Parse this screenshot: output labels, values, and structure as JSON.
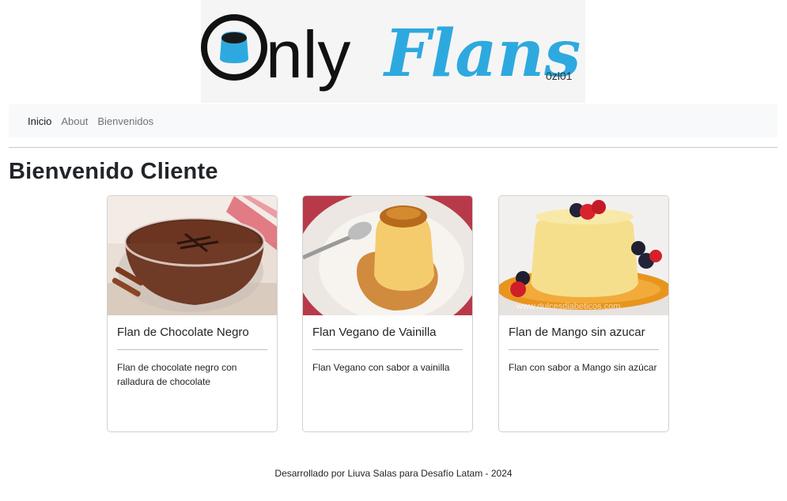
{
  "brand": {
    "logo_text_left": "Only",
    "logo_text_right": "Flans",
    "logo_badge": "0zl01"
  },
  "nav": {
    "items": [
      {
        "label": "Inicio"
      },
      {
        "label": "About"
      },
      {
        "label": "Bienvenidos"
      }
    ]
  },
  "main": {
    "title": "Bienvenido Cliente",
    "cards": [
      {
        "title": "Flan de Chocolate Negro",
        "description": "Flan de chocolate negro con ralladura de chocolate",
        "image": "chocolate-flan-photo"
      },
      {
        "title": "Flan Vegano de Vainilla",
        "description": "Flan Vegano con sabor a vainilla",
        "image": "vanilla-flan-photo"
      },
      {
        "title": "Flan de Mango sin azucar",
        "description": "Flan con sabor a Mango sin azúcar",
        "image": "mango-flan-photo"
      }
    ]
  },
  "footer": {
    "text": "Desarrollado por Liuva Salas para Desafío Latam - 2024"
  },
  "colors": {
    "brand_blue": "#2ea9df",
    "navbar_bg": "#f8f9fa",
    "text": "#212529"
  }
}
